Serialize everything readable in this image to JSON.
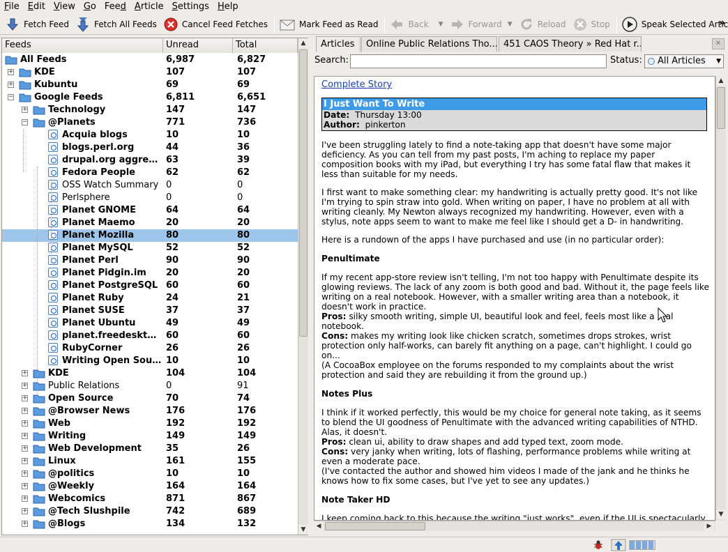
{
  "menu": {
    "items": [
      "File",
      "Edit",
      "View",
      "Go",
      "Feed",
      "Article",
      "Settings",
      "Help"
    ],
    "underline": [
      "F",
      "E",
      "V",
      "G",
      "d",
      "A",
      "S",
      "H"
    ]
  },
  "toolbar": {
    "fetch_feed": "Fetch Feed",
    "fetch_all": "Fetch All Feeds",
    "cancel": "Cancel Feed Fetches",
    "mark_read": "Mark Feed as Read",
    "back": "Back",
    "forward": "Forward",
    "reload": "Reload",
    "stop": "Stop",
    "speak": "Speak Selected Articles",
    "overflow": "»"
  },
  "feeds": {
    "headers": {
      "name": "Feeds",
      "unread": "Unread",
      "total": "Total"
    },
    "rows": [
      {
        "label": "All Feeds",
        "unread": "6,987",
        "total": "6,827"
      },
      {
        "label": "KDE",
        "unread": "107",
        "total": "107"
      },
      {
        "label": "Kubuntu",
        "unread": "69",
        "total": "69"
      },
      {
        "label": "Google Feeds",
        "unread": "6,811",
        "total": "6,651"
      },
      {
        "label": "Technology",
        "unread": "147",
        "total": "147"
      },
      {
        "label": "@Planets",
        "unread": "771",
        "total": "736"
      },
      {
        "label": "Acquia blogs",
        "unread": "10",
        "total": "10"
      },
      {
        "label": "blogs.perl.org",
        "unread": "44",
        "total": "36"
      },
      {
        "label": "drupal.org aggreg...",
        "unread": "63",
        "total": "39"
      },
      {
        "label": "Fedora People",
        "unread": "62",
        "total": "62"
      },
      {
        "label": "OSS Watch Summary",
        "unread": "0",
        "total": "0"
      },
      {
        "label": "Perlsphere",
        "unread": "0",
        "total": "0"
      },
      {
        "label": "Planet GNOME",
        "unread": "64",
        "total": "64"
      },
      {
        "label": "Planet Maemo",
        "unread": "20",
        "total": "20"
      },
      {
        "label": "Planet Mozilla",
        "unread": "80",
        "total": "80"
      },
      {
        "label": "Planet MySQL",
        "unread": "52",
        "total": "52"
      },
      {
        "label": "Planet Perl",
        "unread": "90",
        "total": "90"
      },
      {
        "label": "Planet Pidgin.im",
        "unread": "20",
        "total": "20"
      },
      {
        "label": "Planet PostgreSQL",
        "unread": "60",
        "total": "60"
      },
      {
        "label": "Planet Ruby",
        "unread": "24",
        "total": "21"
      },
      {
        "label": "Planet SUSE",
        "unread": "37",
        "total": "37"
      },
      {
        "label": "Planet Ubuntu",
        "unread": "49",
        "total": "49"
      },
      {
        "label": "planet.freedesktop...",
        "unread": "60",
        "total": "60"
      },
      {
        "label": "RubyCorner",
        "unread": "26",
        "total": "26"
      },
      {
        "label": "Writing Open Sour...",
        "unread": "10",
        "total": "10"
      },
      {
        "label": "KDE",
        "unread": "104",
        "total": "104"
      },
      {
        "label": "Public Relations",
        "unread": "0",
        "total": "91"
      },
      {
        "label": "Open Source",
        "unread": "70",
        "total": "74"
      },
      {
        "label": "@Browser News",
        "unread": "176",
        "total": "176"
      },
      {
        "label": "Web",
        "unread": "192",
        "total": "192"
      },
      {
        "label": "Writing",
        "unread": "149",
        "total": "149"
      },
      {
        "label": "Web Development",
        "unread": "35",
        "total": "26"
      },
      {
        "label": "Linux",
        "unread": "161",
        "total": "155"
      },
      {
        "label": "@politics",
        "unread": "10",
        "total": "10"
      },
      {
        "label": "@Weekly",
        "unread": "164",
        "total": "164"
      },
      {
        "label": "Webcomics",
        "unread": "871",
        "total": "867"
      },
      {
        "label": "@Tech Slushpile",
        "unread": "742",
        "total": "689"
      },
      {
        "label": "@Blogs",
        "unread": "134",
        "total": "132"
      }
    ]
  },
  "tabs": [
    "Articles",
    "Online Public Relations Tho...",
    "451 CAOS Theory » Red Hat r..."
  ],
  "search": {
    "label": "Search:",
    "value": "",
    "status_label": "Status:",
    "status_value": "All Articles"
  },
  "article": {
    "complete_story": "Complete Story",
    "title": "I Just Want To Write",
    "date_label": "Date:",
    "date_value": "Thursday 13:00",
    "author_label": "Author:",
    "author_value": "pinkerton",
    "paragraphs": [
      "I've been struggling lately to find a note-taking app that doesn't have some major deficiency. As you can tell from my past posts, I'm aching to replace my paper composition books with my iPad, but everything I try has some fatal flaw that makes it less than suitable for my needs.",
      "I first want to make something clear: my handwriting is actually pretty good. It's not like I'm trying to spin straw into gold. When writing on paper, I have no problem at all with writing cleanly. My Newton always recognized my handwriting. However, even with a stylus, note apps seem to want to make me feel like I should get a D- in handwriting.",
      "Here is a rundown of the apps I have purchased and use (in no particular order):"
    ],
    "s1_title": "Penultimate",
    "s1_body": "If my recent app-store review isn't telling, I'm not too happy with Penultimate despite its glowing reviews. The lack of any zoom is both good and bad. Without it, the page feels like writing on a real notebook. However, with a smaller writing area than a notebook, it doesn't work in practice.",
    "s1_pros_label": "Pros:",
    "s1_pros": "silky smooth writing, simple UI, beautiful look and feel, feels most like a real notebook.",
    "s1_cons_label": "Cons:",
    "s1_cons": "makes my writing look like chicken scratch, sometimes drops strokes, wrist protection only half-works, can barely fit anything on a page, can't highlight. I could go on...",
    "s1_note": "(A CocoaBox employee on the forums responded to my complaints about the wrist protection and said they are rebuilding it from the ground up.)",
    "s2_title": "Notes Plus",
    "s2_body": "I think if it worked perfectly, this would be my choice for general note taking, as it seems to blend the UI goodness of Penultimate with the advanced writing capabilities of NTHD. Alas, it doesn't.",
    "s2_pros_label": "Pros:",
    "s2_pros": "clean ui, ability to draw shapes and add typed text, zoom mode.",
    "s2_cons_label": "Cons:",
    "s2_cons": "very janky when writing, lots of flashing, performance problems while writing at even a moderate pace.",
    "s2_note": "(I've contacted the author and showed him videos I made of the jank and he thinks he knows how to fix some cases, but I've yet to see any updates.)",
    "s3_title": "Note Taker HD",
    "s3_body": "I keep coming back to this because the writing \"just works\", even if the UI is spectacularly"
  },
  "colors": {
    "selection": "#9ec6ea",
    "header_bar": "#3d9be8",
    "link": "#1a3fa8",
    "folder": "#5b9be0"
  }
}
